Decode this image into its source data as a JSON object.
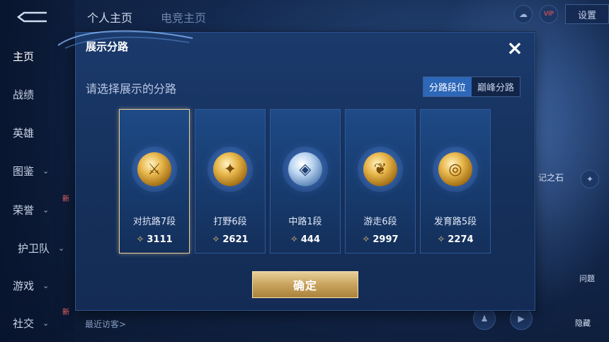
{
  "nav": {
    "items": [
      {
        "label": "主页",
        "chevron": ""
      },
      {
        "label": "战绩",
        "chevron": ""
      },
      {
        "label": "英雄",
        "chevron": ""
      },
      {
        "label": "图鉴",
        "chevron": "⌄"
      },
      {
        "label": "荣誉",
        "chevron": "⌄"
      },
      {
        "label": "护卫队",
        "chevron": "⌄"
      },
      {
        "label": "游戏",
        "chevron": "⌄"
      },
      {
        "label": "社交",
        "chevron": "⌄"
      }
    ],
    "new_badge": "新"
  },
  "top": {
    "tabs": [
      "个人主页",
      "电竞主页"
    ],
    "settings_label": "设置",
    "vip_label": "VIP"
  },
  "dialog": {
    "title": "展示分路",
    "subtitle": "请选择展示的分路",
    "close_icon": "×",
    "segments": [
      "分路段位",
      "巅峰分路"
    ],
    "confirm_label": "确定"
  },
  "cards": [
    {
      "rank": "对抗路7段",
      "score": "3111",
      "icon": "⚔",
      "medal": "gold",
      "selected": true
    },
    {
      "rank": "打野6段",
      "score": "2621",
      "icon": "✦",
      "medal": "gold",
      "selected": false
    },
    {
      "rank": "中路1段",
      "score": "444",
      "icon": "◈",
      "medal": "silver",
      "selected": false
    },
    {
      "rank": "游走6段",
      "score": "2997",
      "icon": "❦",
      "medal": "gold",
      "selected": false
    },
    {
      "rank": "发育路5段",
      "score": "2274",
      "icon": "◎",
      "medal": "gold",
      "selected": false
    }
  ],
  "bottom": {
    "visitors_label": "最近访客>"
  },
  "right_side": {
    "stone_label": "记之石",
    "badge_1": "问题",
    "badge_2": "隐藏"
  }
}
